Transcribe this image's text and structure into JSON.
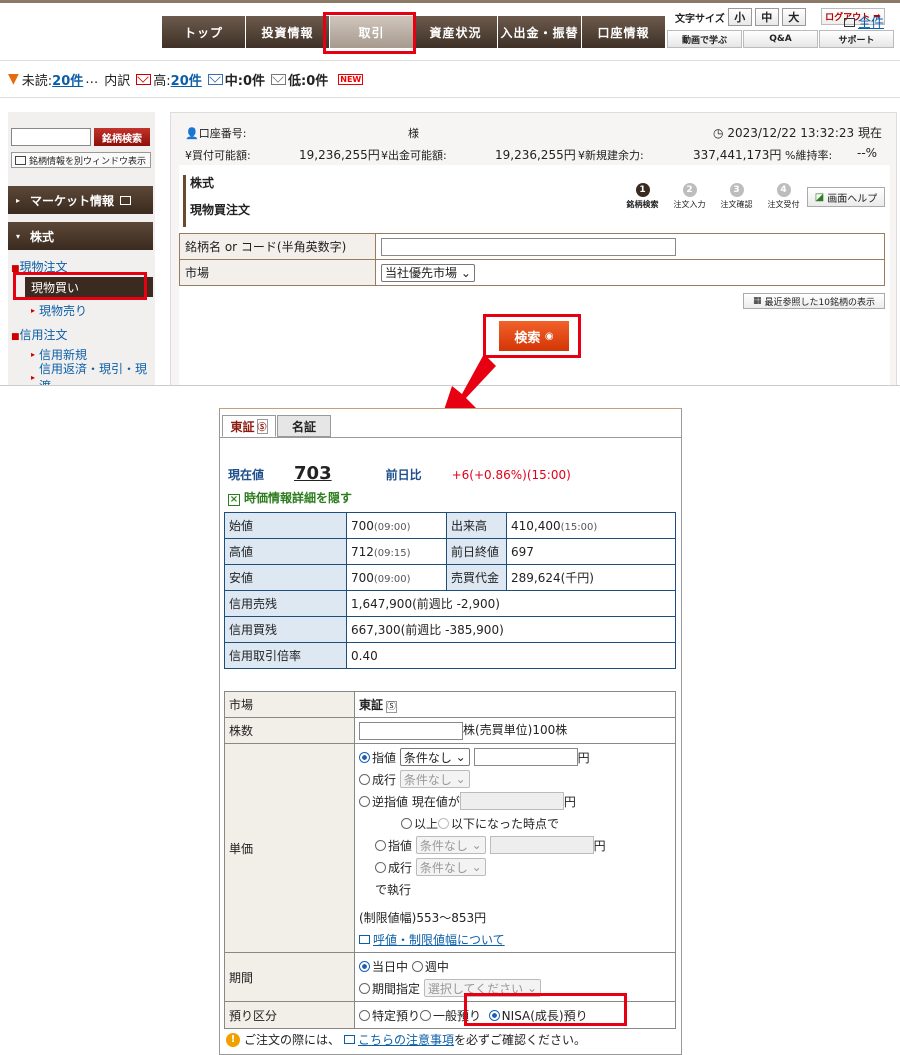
{
  "nav": {
    "items": [
      "トップ",
      "投資情報",
      "取引",
      "資産状況",
      "入出金・振替",
      "口座情報"
    ],
    "active_index": 2,
    "fontsize_label": "文字サイズ",
    "fontsize_options": [
      "小",
      "中",
      "大"
    ],
    "logout": "ログアウト",
    "sub_items": [
      "動画で学ぶ",
      "Q&A",
      "サポート"
    ]
  },
  "messages": {
    "unread_label": "未読:",
    "unread_count": "20件",
    "breakdown_label": "内訳",
    "high_label": "高:",
    "high_count": "20件",
    "mid_label": "中:0件",
    "low_label": "低:0件",
    "new_badge": "NEW",
    "all_link": "全件"
  },
  "sidebar": {
    "search_button": "銘柄検索",
    "new_window": "銘柄情報を別ウィンドウ表示",
    "market_info": "マーケット情報",
    "stocks": "株式",
    "spot_order": "現物注文",
    "spot_buy": "現物買い",
    "spot_sell": "現物売り",
    "margin_order": "信用注文",
    "margin_new": "信用新規",
    "margin_close": "信用返済・現引・現渡"
  },
  "account": {
    "number_label": "口座番号:",
    "suffix": "様",
    "datetime": "2023/12/22 13:32:23 現在",
    "buying_power_label": "¥買付可能額:",
    "buying_power": "19,236,255円",
    "withdraw_label": "¥出金可能額:",
    "withdraw": "19,236,255円",
    "new_margin_label": "¥新規建余力:",
    "new_margin": "337,441,173円",
    "maintenance_label": "%維持率:",
    "maintenance": "--%"
  },
  "order_form": {
    "category": "株式",
    "title": "現物買注文",
    "steps": [
      "銘柄検索",
      "注文入力",
      "注文確認",
      "注文受付"
    ],
    "help_button": "画面ヘルプ",
    "code_label": "銘柄名 or コード(半角英数字)",
    "market_label": "市場",
    "market_value": "当社優先市場",
    "recent_button": "最近参照した10銘柄の表示",
    "search_button": "検索"
  },
  "quote": {
    "tabs": [
      "東証",
      "名証"
    ],
    "price_label": "現在値",
    "price": "703",
    "change_label": "前日比",
    "change": "+6(+0.86%)(15:00)",
    "hide_detail": "時価情報詳細を隠す",
    "rows": [
      {
        "l1": "始値",
        "v1": "700",
        "t1": "(09:00)",
        "l2": "出来高",
        "v2": "410,400",
        "t2": "(15:00)"
      },
      {
        "l1": "高値",
        "v1": "712",
        "t1": "(09:15)",
        "l2": "前日終値",
        "v2": "697",
        "t2": ""
      },
      {
        "l1": "安値",
        "v1": "700",
        "t1": "(09:00)",
        "l2": "売買代金",
        "v2": "289,624(千円)",
        "t2": ""
      }
    ],
    "margin_sell_label": "信用売残",
    "margin_sell": "1,647,900(前週比 -2,900)",
    "margin_buy_label": "信用買残",
    "margin_buy": "667,300(前週比 -385,900)",
    "margin_ratio_label": "信用取引倍率",
    "margin_ratio": "0.40"
  },
  "order": {
    "market_label": "市場",
    "market_value": "東証",
    "shares_label": "株数",
    "shares_unit": "株(売買単位)100株",
    "price_label": "単価",
    "limit": "指値",
    "no_condition": "条件なし",
    "yen": "円",
    "market_order": "成行",
    "stop_order": "逆指値",
    "current_price_when": "現在値が",
    "above": "以上",
    "below_when": "以下になった時点で",
    "execute": "で執行",
    "price_range": "(制限値幅)553〜853円",
    "tick_link": "呼値・制限値幅について",
    "period_label": "期間",
    "today": "当日中",
    "this_week": "週中",
    "period_specify": "期間指定",
    "select_placeholder": "選択してください",
    "account_label": "預り区分",
    "specific": "特定預り",
    "general": "一般預り",
    "nisa": "NISA(成長)預り",
    "notice_prefix": "ご注文の際には、",
    "notice_link": "こちらの注意事項",
    "notice_suffix": "を必ずご確認ください。"
  },
  "colors": {
    "highlight": "#e60012",
    "nav": "#4a3a2e",
    "positive": "#e0001a"
  }
}
